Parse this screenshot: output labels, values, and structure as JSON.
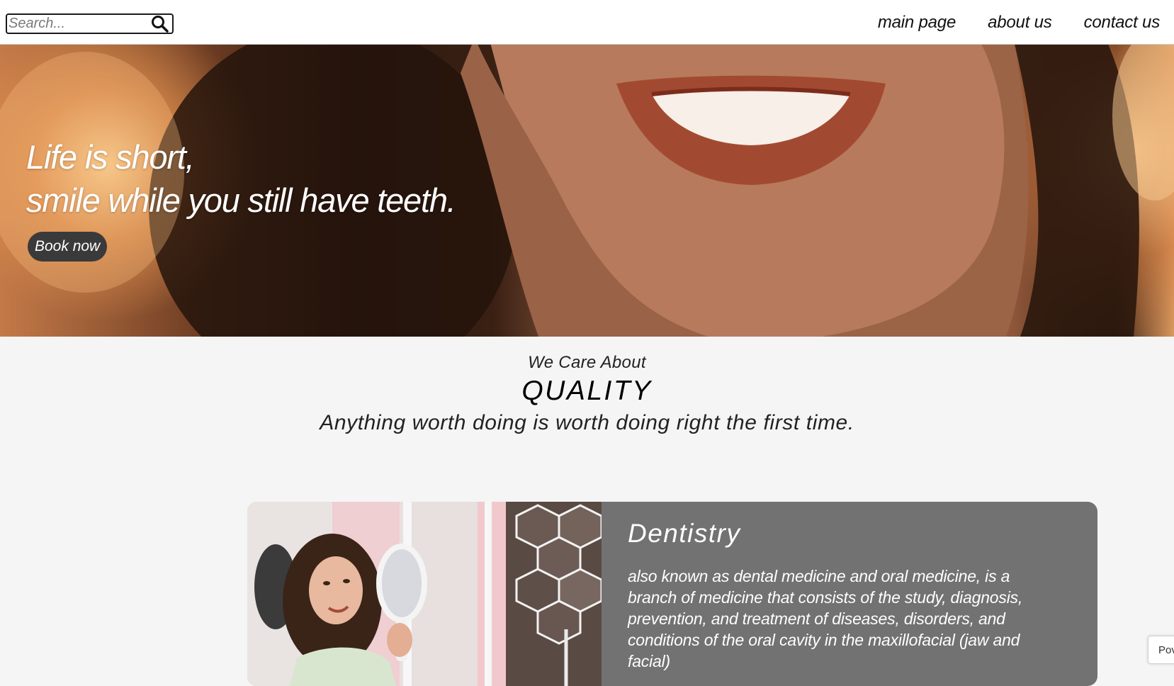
{
  "header": {
    "search": {
      "placeholder": "Search...",
      "value": ""
    },
    "nav": [
      {
        "label": "main page"
      },
      {
        "label": "about us"
      },
      {
        "label": "contact us"
      }
    ]
  },
  "hero": {
    "headline_line1": "Life is short,",
    "headline_line2": "smile while you still have teeth.",
    "cta_label": "Book now"
  },
  "quality": {
    "eyebrow": "We Care About",
    "title": "QUALITY",
    "motto": "Anything worth doing is worth doing right the first time."
  },
  "card": {
    "title": "Dentistry",
    "text": "also known as dental medicine and oral medicine, is a branch of medicine that consists of the study, diagnosis, prevention, and treatment of diseases, disorders, and conditions of the oral cavity in the maxillofacial (jaw and facial)"
  },
  "corner_badge": {
    "label": "Pov"
  },
  "icons": {
    "search": "search-icon"
  }
}
